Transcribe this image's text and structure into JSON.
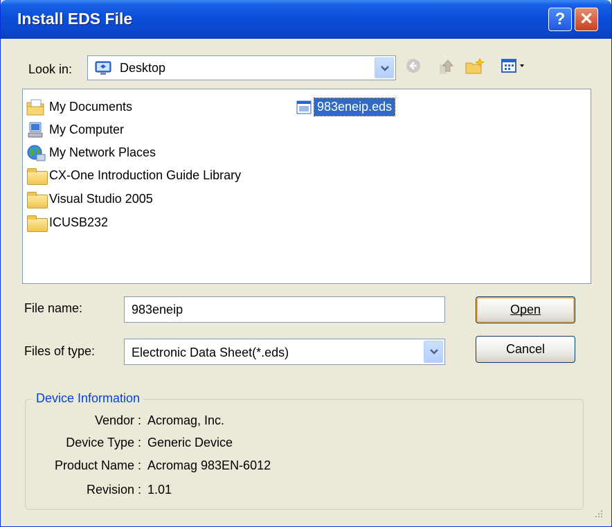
{
  "window": {
    "title": "Install EDS File",
    "help_glyph": "?",
    "close_glyph": "✕"
  },
  "look_in": {
    "label": "Look in:",
    "value": "Desktop",
    "icon": "desktop-icon"
  },
  "toolbar": {
    "icons": [
      "back-icon",
      "up-folder-icon",
      "new-folder-icon",
      "view-menu-icon"
    ]
  },
  "files": {
    "items": [
      {
        "label": "My Documents",
        "icon": "my-documents-icon"
      },
      {
        "label": "My Computer",
        "icon": "my-computer-icon"
      },
      {
        "label": "My Network Places",
        "icon": "network-places-icon"
      },
      {
        "label": "CX-One Introduction Guide Library",
        "icon": "folder-icon"
      },
      {
        "label": "Visual Studio 2005",
        "icon": "folder-icon"
      },
      {
        "label": "ICUSB232",
        "icon": "folder-icon"
      },
      {
        "label": "983eneip.eds",
        "icon": "eds-file-icon",
        "selected": true
      }
    ]
  },
  "file_name": {
    "label": "File name:",
    "value": "983eneip"
  },
  "file_type": {
    "label": "Files of type:",
    "value": "Electronic Data Sheet(*.eds)"
  },
  "buttons": {
    "open": "Open",
    "cancel": "Cancel"
  },
  "device_info": {
    "title": "Device Information",
    "vendor_label": "Vendor :",
    "vendor": "Acromag, Inc.",
    "type_label": "Device Type :",
    "type": "Generic Device",
    "product_label": "Product Name :",
    "product": "Acromag 983EN-6012",
    "revision_label": "Revision :",
    "revision": "1.01"
  },
  "colors": {
    "titlebar": "#0a4fd8",
    "dialog_bg": "#ece9d8",
    "selection": "#316ac5",
    "group_title": "#0046d5"
  }
}
